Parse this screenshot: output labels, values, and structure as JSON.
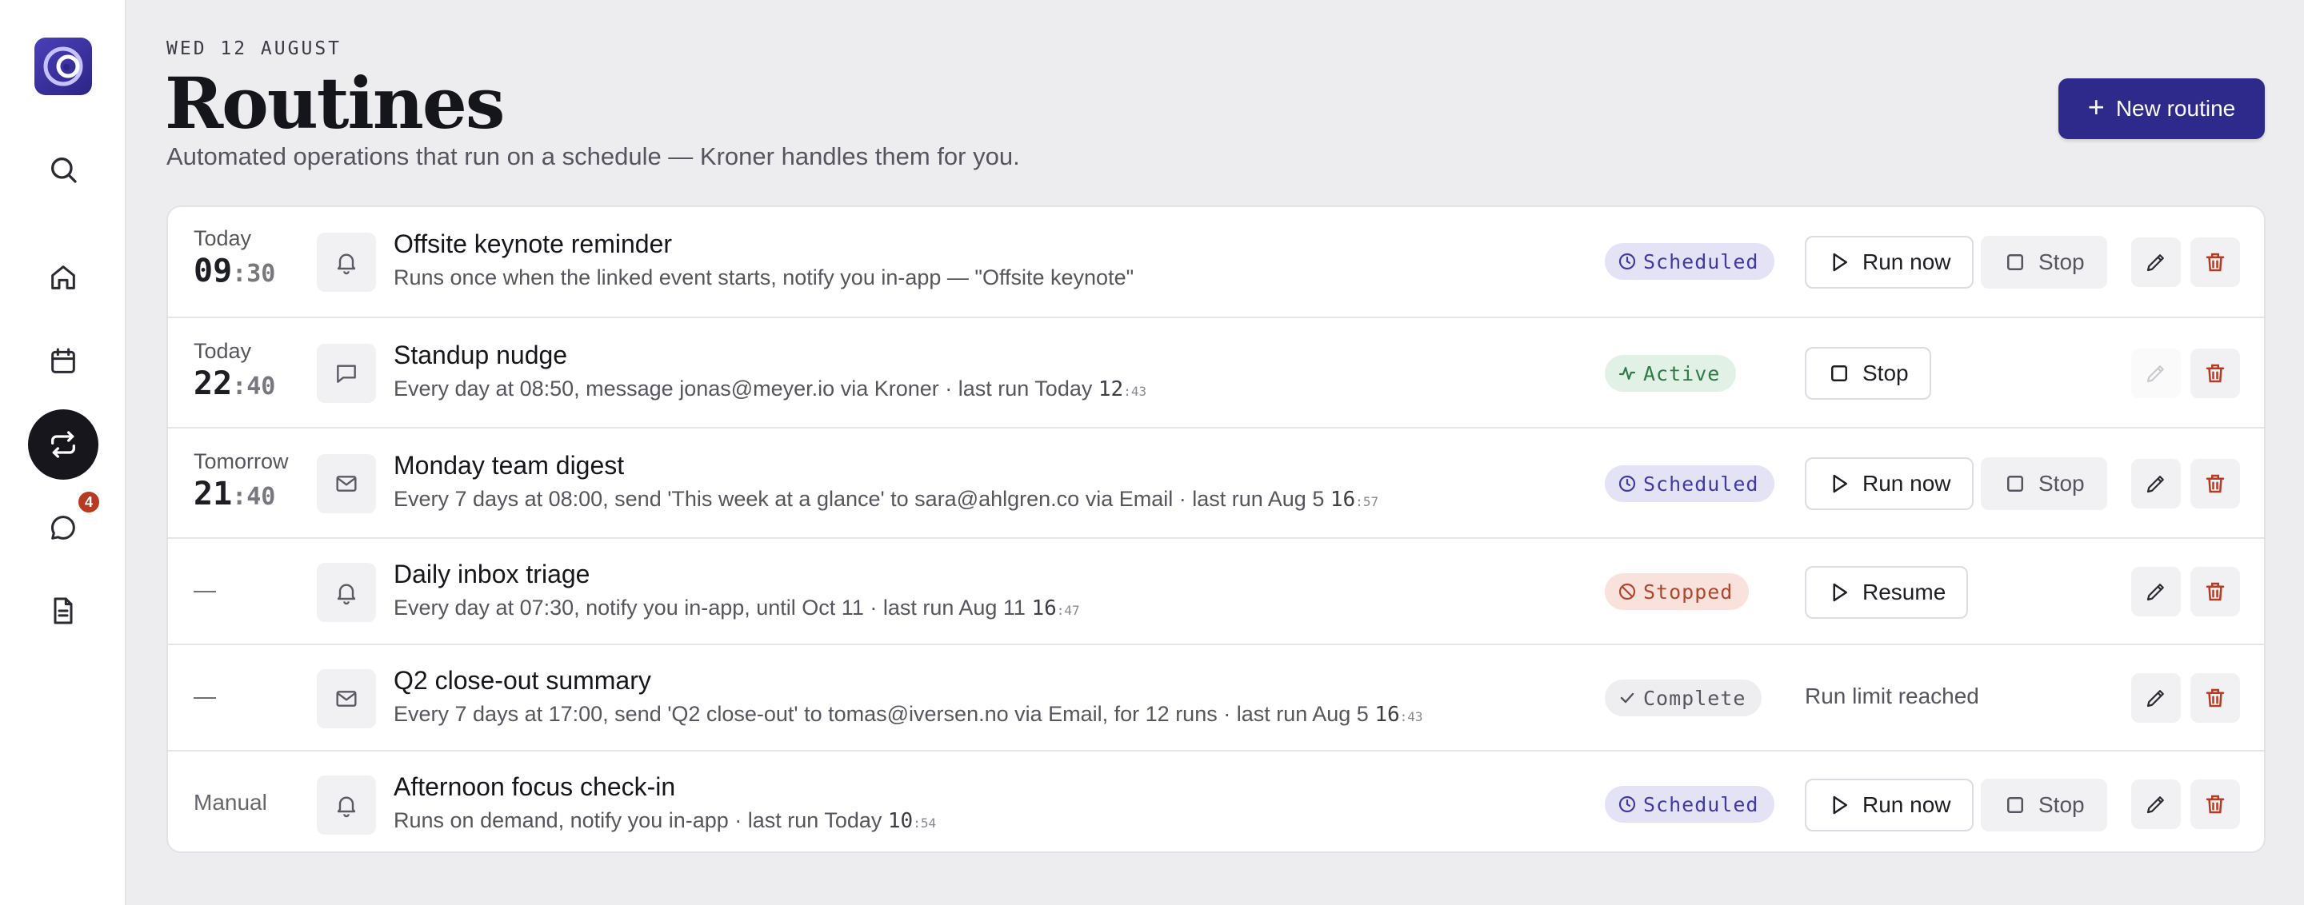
{
  "sidebar": {
    "icons": [
      "logo",
      "search-icon",
      "home-icon",
      "calendar-icon",
      "routines-icon",
      "chat-icon",
      "document-icon"
    ],
    "active": "routines",
    "chat_badge": "4"
  },
  "header": {
    "date": "WED 12 AUGUST",
    "title": "Routines",
    "subtitle": "Automated operations that run on a schedule — Kroner handles them for you.",
    "new_button": "New routine"
  },
  "colors": {
    "brand": "#2e2a8c",
    "scheduled": "#3f3aa0",
    "active": "#2f7a47",
    "stopped": "#b0462e",
    "delete": "#b73a22"
  },
  "routines": [
    {
      "day": "Today",
      "hour": "09",
      "min": "30",
      "icon": "bell-icon",
      "name": "Offsite keynote reminder",
      "desc": "Runs once when the linked event starts, notify you in-app — \"Offsite keynote\"",
      "status": "Scheduled",
      "run_label": "Run now",
      "stop_label": "Stop"
    },
    {
      "day": "Today",
      "hour": "22",
      "min": "40",
      "icon": "message-icon",
      "name": "Standup nudge",
      "desc": "Every day at 08:50, message jonas@meyer.io via Kroner · last run Today",
      "last_run_hm": "12",
      "last_run_s": "43",
      "status": "Active",
      "stop_label": "Stop"
    },
    {
      "day": "Tomorrow",
      "hour": "21",
      "min": "40",
      "icon": "mail-icon",
      "name": "Monday team digest",
      "desc": "Every 7 days at 08:00, send 'This week at a glance' to sara@ahlgren.co via Email · last run Aug 5",
      "last_run_hm": "16",
      "last_run_s": "57",
      "status": "Scheduled",
      "run_label": "Run now",
      "stop_label": "Stop"
    },
    {
      "day": "—",
      "icon": "bell-icon",
      "name": "Daily inbox triage",
      "desc": "Every day at 07:30, notify you in-app, until Oct 11 · last run Aug 11",
      "last_run_hm": "16",
      "last_run_s": "47",
      "status": "Stopped",
      "resume_label": "Resume"
    },
    {
      "day": "—",
      "icon": "mail-icon",
      "name": "Q2 close-out summary",
      "desc": "Every 7 days at 17:00, send 'Q2 close-out' to tomas@iversen.no via Email, for 12 runs · last run Aug 5",
      "last_run_hm": "16",
      "last_run_s": "43",
      "status": "Complete",
      "limit_text": "Run limit reached"
    },
    {
      "day": "Manual",
      "icon": "bell-icon",
      "name": "Afternoon focus check-in",
      "desc": "Runs on demand, notify you in-app · last run Today",
      "last_run_hm": "10",
      "last_run_s": "54",
      "status": "Scheduled",
      "run_label": "Run now",
      "stop_label": "Stop"
    }
  ]
}
